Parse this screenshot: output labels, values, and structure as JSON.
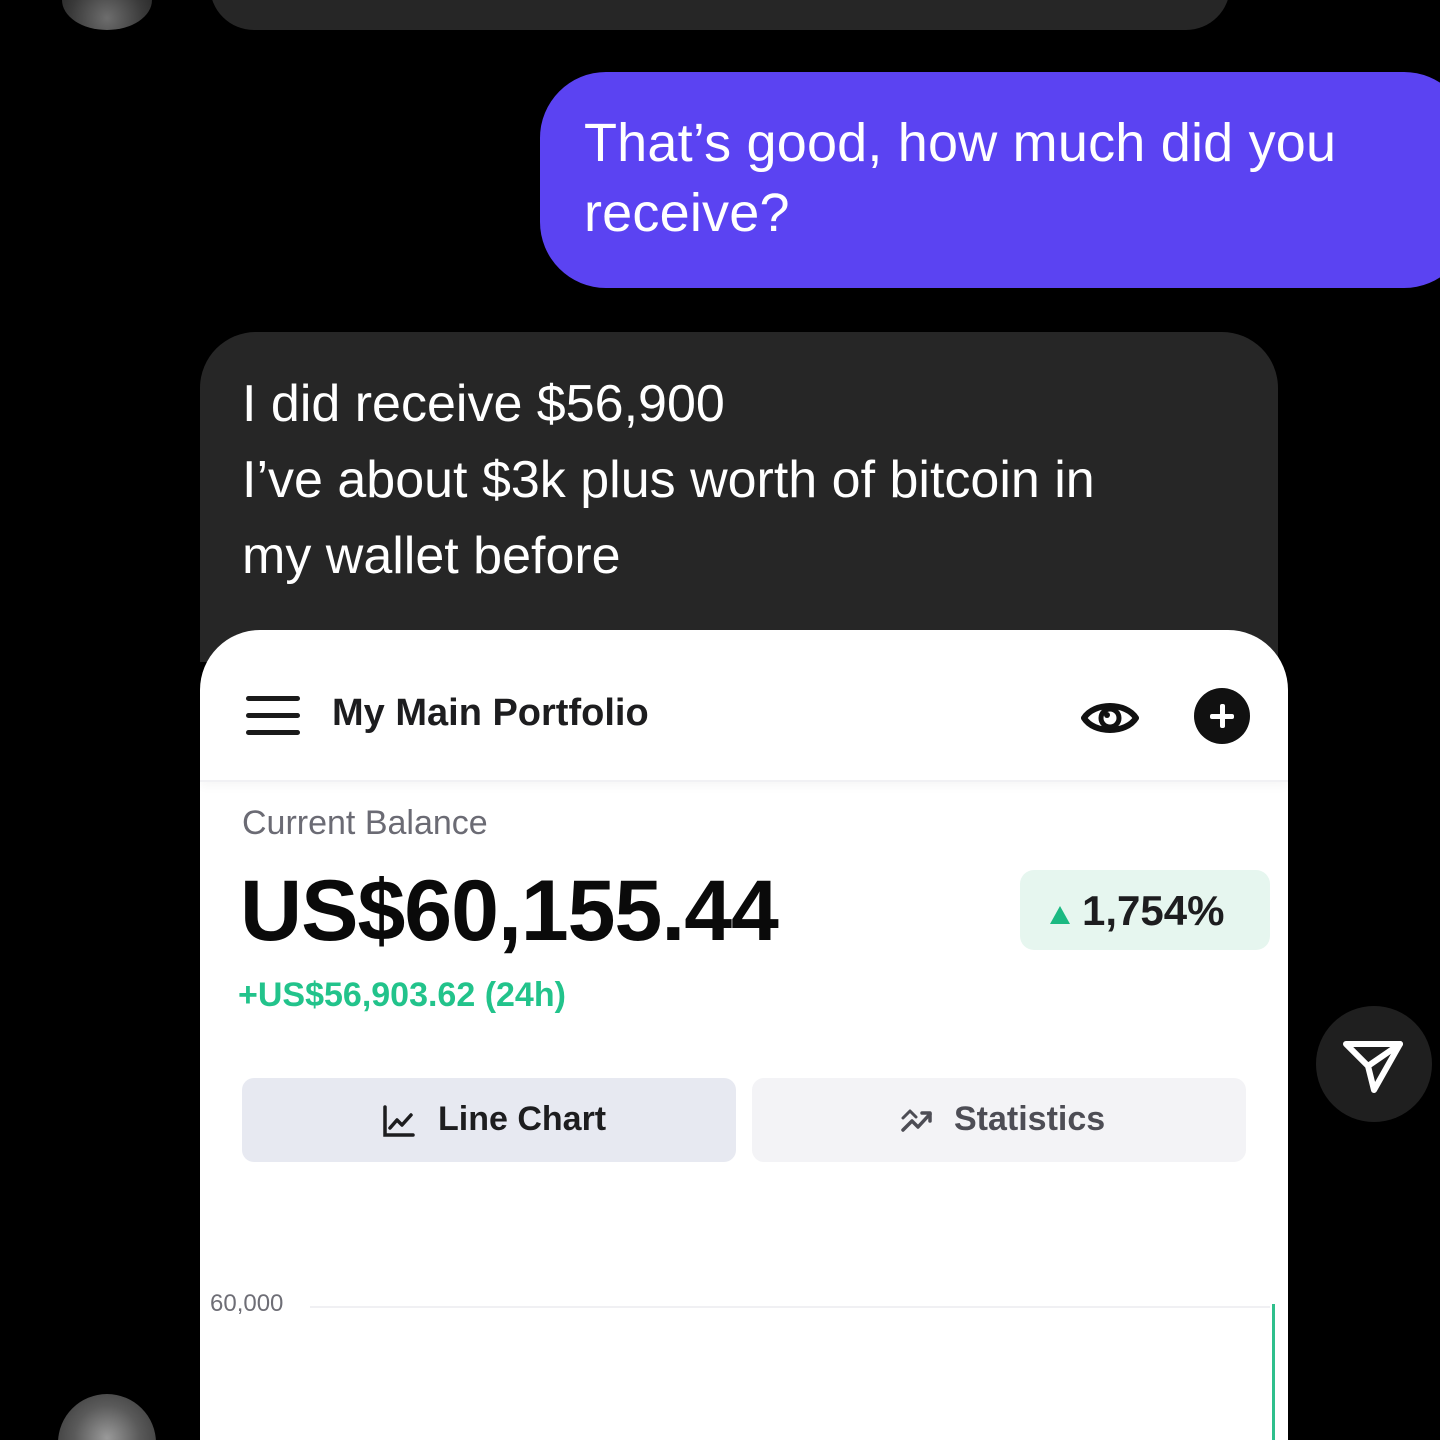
{
  "messages": {
    "outgoing": "That’s good, how much did you\nreceive?",
    "incoming": "I did receive $56,900\nI’ve about $3k plus worth of bitcoin in\nmy wallet before"
  },
  "portfolio_card": {
    "title": "My Main Portfolio",
    "balance_label": "Current Balance",
    "balance_value": "US$60,155.44",
    "change_percent": "1,754%",
    "change_24h": "+US$56,903.62 (24h)",
    "tabs": [
      {
        "label": "Line Chart",
        "icon": "line-chart-icon",
        "active": true
      },
      {
        "label": "Statistics",
        "icon": "statistics-icon",
        "active": false
      }
    ],
    "chart": {
      "y_tick": "60,000"
    }
  },
  "colors": {
    "outgoing_bubble": "#5b43f2",
    "incoming_bubble": "#262626",
    "positive_green": "#22c38b",
    "badge_bg": "#e6f6ef"
  },
  "icons": {
    "menu": "hamburger-menu-icon",
    "visibility": "eye-icon",
    "add": "plus-icon",
    "send": "send-icon"
  }
}
